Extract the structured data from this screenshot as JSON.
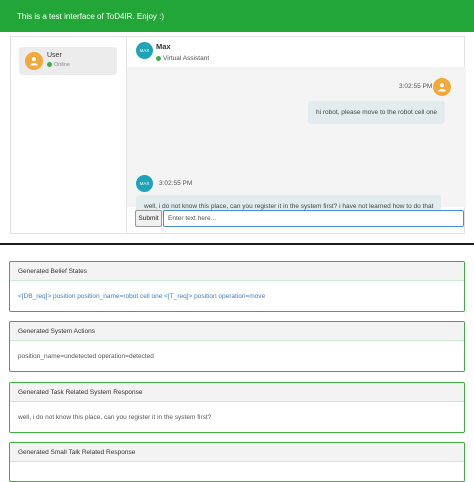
{
  "banner": {
    "text": "This is a test interface of ToD4IR. Enjoy :)"
  },
  "colors": {
    "banner": "#21a637",
    "accent_border": "#3cb043",
    "bot_avatar": "#1fa3b8",
    "user_avatar": "#f2a83a",
    "online": "#3cb043"
  },
  "sidebar": {
    "contacts": [
      {
        "name": "User",
        "status": "Online",
        "icon": "user-avatar-icon"
      }
    ]
  },
  "chat_header": {
    "avatar_text": "MAX",
    "name": "Max",
    "status": "Virtual Assistant"
  },
  "messages": [
    {
      "sender": "user",
      "time": "3:02:55 PM",
      "text": "hi robot, please move to the robot cell one"
    },
    {
      "sender": "bot",
      "avatar_text": "MAX",
      "time": "3:02:55 PM",
      "text": "well, i do not know this place, can you register it in the system first? i have not learned how to do that"
    }
  ],
  "composer": {
    "submit_label": "Submit",
    "placeholder": "Enter text here..."
  },
  "panels": [
    {
      "title": "Generated Belief States",
      "body": "<[DB_req]> position position_name=robot cell one <[T_req]> position operation=move"
    },
    {
      "title": "Generated System Actions",
      "body": "position_name=undetected operation=detected"
    },
    {
      "title": "Generated Task Related System Response",
      "body": "well, i do not know this place, can you register it in the system first?"
    },
    {
      "title": "Generated Small Talk Related Response",
      "body": ""
    }
  ]
}
